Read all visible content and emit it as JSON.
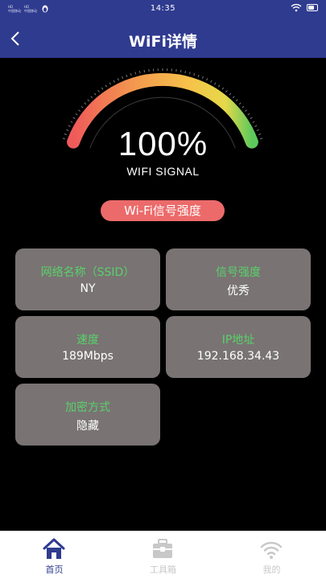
{
  "status": {
    "time": "14:35",
    "sim1": [
      "HD",
      "中国移动"
    ],
    "sim2": [
      "HD",
      "中国移动"
    ]
  },
  "nav": {
    "title": "WiFi详情"
  },
  "gauge": {
    "value": "100%",
    "caption": "WIFI SIGNAL",
    "level": 1.0
  },
  "signal_pill": "Wi-Fi信号强度",
  "cards": [
    {
      "label": "网络名称（SSID）",
      "value": "NY"
    },
    {
      "label": "信号强度",
      "value": "优秀"
    },
    {
      "label": "速度",
      "value": "189Mbps"
    },
    {
      "label": "IP地址",
      "value": "192.168.34.43"
    },
    {
      "label": "加密方式",
      "value": "隐藏"
    }
  ],
  "tabs": [
    {
      "label": "首页",
      "icon": "home-icon",
      "active": true
    },
    {
      "label": "工具箱",
      "icon": "toolbox-icon",
      "active": false
    },
    {
      "label": "我的",
      "icon": "wifi-icon",
      "active": false
    }
  ],
  "colors": {
    "primary": "#2f3b8f",
    "card_bg": "#797373",
    "label_green": "#59d26a",
    "pill": "#ec6a6a",
    "tab_active": "#2f3b8f",
    "tab_inactive": "#c8c8c8"
  }
}
